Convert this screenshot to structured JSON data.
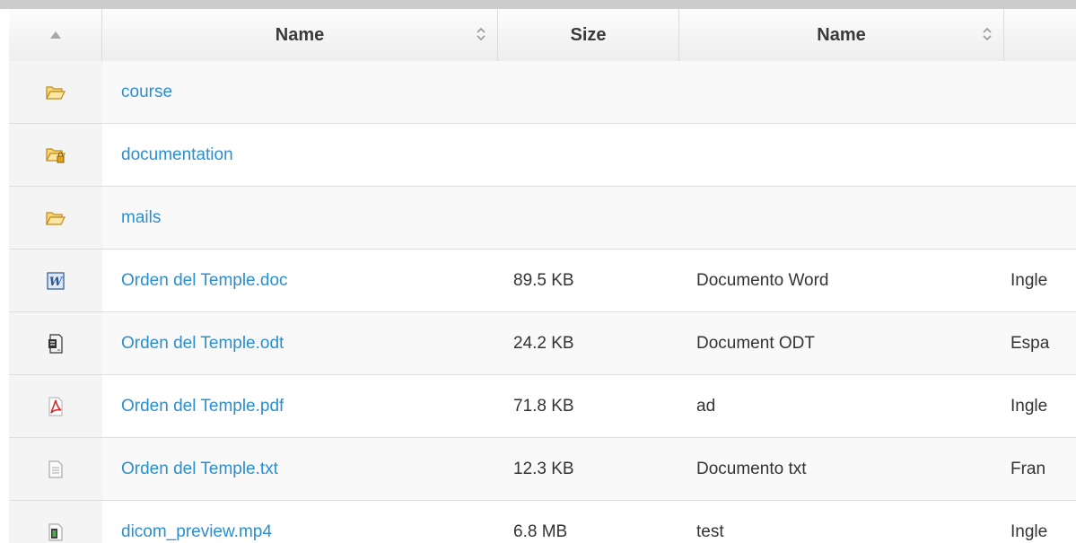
{
  "header": {
    "col_sort_icon": "triangle-up-icon",
    "col_name": "Name",
    "col_size": "Size",
    "col_desc": "Name"
  },
  "rows": [
    {
      "icon": "folder-open-icon",
      "name": "course",
      "size": "",
      "desc": "",
      "lang": ""
    },
    {
      "icon": "folder-locked-icon",
      "name": "documentation",
      "size": "",
      "desc": "",
      "lang": ""
    },
    {
      "icon": "folder-open-icon",
      "name": "mails",
      "size": "",
      "desc": "",
      "lang": ""
    },
    {
      "icon": "word-doc-icon",
      "name": "Orden del Temple.doc",
      "size": "89.5 KB",
      "desc": "Documento Word",
      "lang": "Ingle"
    },
    {
      "icon": "odt-doc-icon",
      "name": "Orden del Temple.odt",
      "size": "24.2 KB",
      "desc": "Document ODT",
      "lang": "Espa"
    },
    {
      "icon": "pdf-icon",
      "name": "Orden del Temple.pdf",
      "size": "71.8 KB",
      "desc": "ad",
      "lang": "Ingle"
    },
    {
      "icon": "text-file-icon",
      "name": "Orden del Temple.txt",
      "size": "12.3 KB",
      "desc": "Documento txt",
      "lang": "Fran"
    },
    {
      "icon": "video-file-icon",
      "name": "dicom_preview.mp4",
      "size": "6.8 MB",
      "desc": "test",
      "lang": "Ingle"
    }
  ],
  "colors": {
    "link": "#2a8fd0",
    "folder": "#f0b429"
  }
}
